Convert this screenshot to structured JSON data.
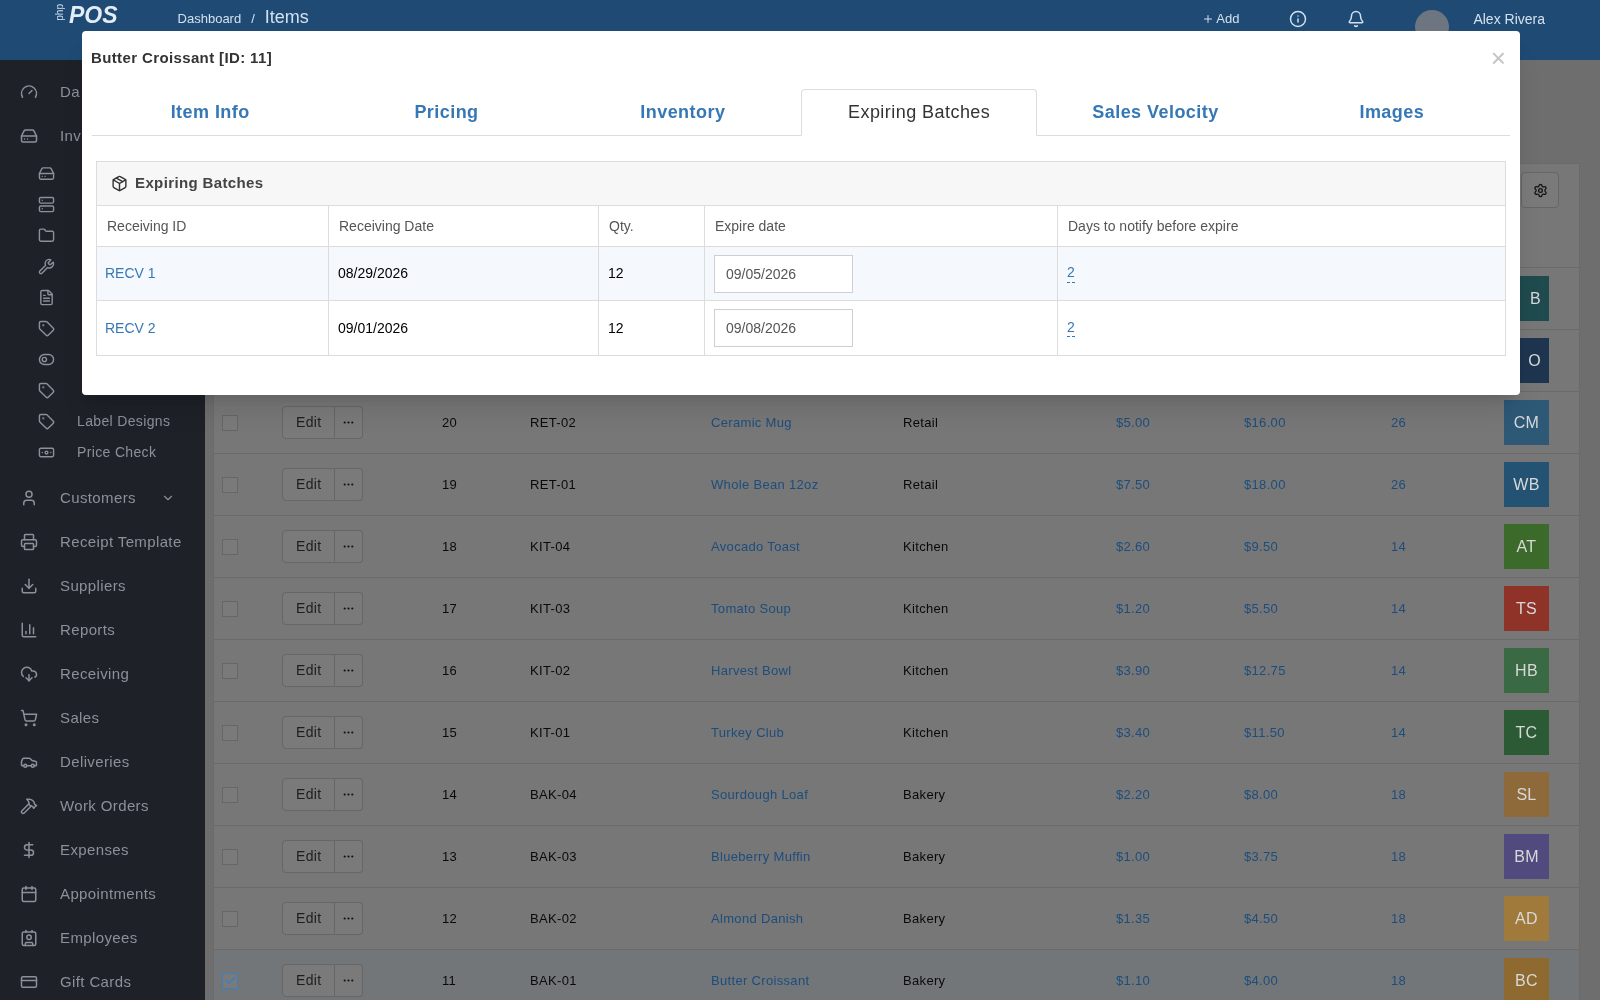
{
  "navbar": {
    "logo_small": "php",
    "logo": "POS",
    "breadcrumb": [
      "Dashboard",
      "Items"
    ],
    "separator": "/",
    "add": "Add",
    "user": "Alex Rivera"
  },
  "sidebar": {
    "items": [
      {
        "label": "Da"
      },
      {
        "label": "Inv",
        "children": [
          {
            "kind": "icon"
          },
          {
            "kind": "icon"
          },
          {
            "kind": "icon"
          },
          {
            "kind": "icon"
          },
          {
            "kind": "icon"
          },
          {
            "kind": "icon"
          },
          {
            "kind": "icon"
          },
          {
            "kind": "icon"
          },
          {
            "kind": "link",
            "label": "Label Designs"
          },
          {
            "kind": "link",
            "label": "Price Check"
          }
        ]
      },
      {
        "label": "Customers",
        "expanded": false
      },
      {
        "label": "Receipt Template"
      },
      {
        "label": "Suppliers"
      },
      {
        "label": "Reports"
      },
      {
        "label": "Receiving"
      },
      {
        "label": "Sales"
      },
      {
        "label": "Deliveries"
      },
      {
        "label": "Work Orders"
      },
      {
        "label": "Expenses"
      },
      {
        "label": "Appointments"
      },
      {
        "label": "Employees"
      },
      {
        "label": "Gift Cards"
      }
    ]
  },
  "items_table": {
    "rows": [
      {
        "thumb": "B",
        "color": "#1f4a4e"
      },
      {
        "thumb": "O",
        "color": "#1e3550"
      },
      {
        "checked": false,
        "edit": "Edit",
        "id": "20",
        "number": "RET-02",
        "name": "Ceramic Mug",
        "category": "Retail",
        "cost": "$5.00",
        "price": "$16.00",
        "qty": "26",
        "thumb": "CM",
        "color": "#2d5876"
      },
      {
        "checked": false,
        "edit": "Edit",
        "id": "19",
        "number": "RET-01",
        "name": "Whole Bean 12oz",
        "category": "Retail",
        "cost": "$7.50",
        "price": "$18.00",
        "qty": "26",
        "thumb": "WB",
        "color": "#245273"
      },
      {
        "checked": false,
        "edit": "Edit",
        "id": "18",
        "number": "KIT-04",
        "name": "Avocado Toast",
        "category": "Kitchen",
        "cost": "$2.60",
        "price": "$9.50",
        "qty": "14",
        "thumb": "AT",
        "color": "#3b6a2b"
      },
      {
        "checked": false,
        "edit": "Edit",
        "id": "17",
        "number": "KIT-03",
        "name": "Tomato Soup",
        "category": "Kitchen",
        "cost": "$1.20",
        "price": "$5.50",
        "qty": "14",
        "thumb": "TS",
        "color": "#8f3329"
      },
      {
        "checked": false,
        "edit": "Edit",
        "id": "16",
        "number": "KIT-02",
        "name": "Harvest Bowl",
        "category": "Kitchen",
        "cost": "$3.90",
        "price": "$12.75",
        "qty": "14",
        "thumb": "HB",
        "color": "#3a6a44"
      },
      {
        "checked": false,
        "edit": "Edit",
        "id": "15",
        "number": "KIT-01",
        "name": "Turkey Club",
        "category": "Kitchen",
        "cost": "$3.40",
        "price": "$11.50",
        "qty": "14",
        "thumb": "TC",
        "color": "#2b5a35"
      },
      {
        "checked": false,
        "edit": "Edit",
        "id": "14",
        "number": "BAK-04",
        "name": "Sourdough Loaf",
        "category": "Bakery",
        "cost": "$2.20",
        "price": "$8.00",
        "qty": "18",
        "thumb": "SL",
        "color": "#8e6a3a"
      },
      {
        "checked": false,
        "edit": "Edit",
        "id": "13",
        "number": "BAK-03",
        "name": "Blueberry Muffin",
        "category": "Bakery",
        "cost": "$1.00",
        "price": "$3.75",
        "qty": "18",
        "thumb": "BM",
        "color": "#514a7e"
      },
      {
        "checked": false,
        "edit": "Edit",
        "id": "12",
        "number": "BAK-02",
        "name": "Almond Danish",
        "category": "Bakery",
        "cost": "$1.35",
        "price": "$4.50",
        "qty": "18",
        "thumb": "AD",
        "color": "#a07a3a"
      },
      {
        "checked": true,
        "edit": "Edit",
        "id": "11",
        "number": "BAK-01",
        "name": "Butter Croissant",
        "category": "Bakery",
        "cost": "$1.10",
        "price": "$4.00",
        "qty": "18",
        "thumb": "BC",
        "color": "#8f6a30"
      }
    ]
  },
  "modal": {
    "title": "Butter Croissant [ID: 11]",
    "close": "×",
    "tabs": [
      {
        "label": "Item Info",
        "selected": false
      },
      {
        "label": "Pricing",
        "selected": false
      },
      {
        "label": "Inventory",
        "selected": false
      },
      {
        "label": "Expiring Batches",
        "selected": true
      },
      {
        "label": "Sales Velocity",
        "selected": false
      },
      {
        "label": "Images",
        "selected": false
      }
    ],
    "panel": {
      "title": "Expiring Batches",
      "columns": [
        "Receiving ID",
        "Receiving Date",
        "Qty.",
        "Expire date",
        "Days to notify before expire"
      ],
      "rows": [
        {
          "receiving_id": "RECV 1",
          "receiving_date": "08/29/2026",
          "qty": "12",
          "expire_date": "09/05/2026",
          "days": "2"
        },
        {
          "receiving_id": "RECV 2",
          "receiving_date": "09/01/2026",
          "qty": "12",
          "expire_date": "09/08/2026",
          "days": "2"
        }
      ]
    }
  }
}
